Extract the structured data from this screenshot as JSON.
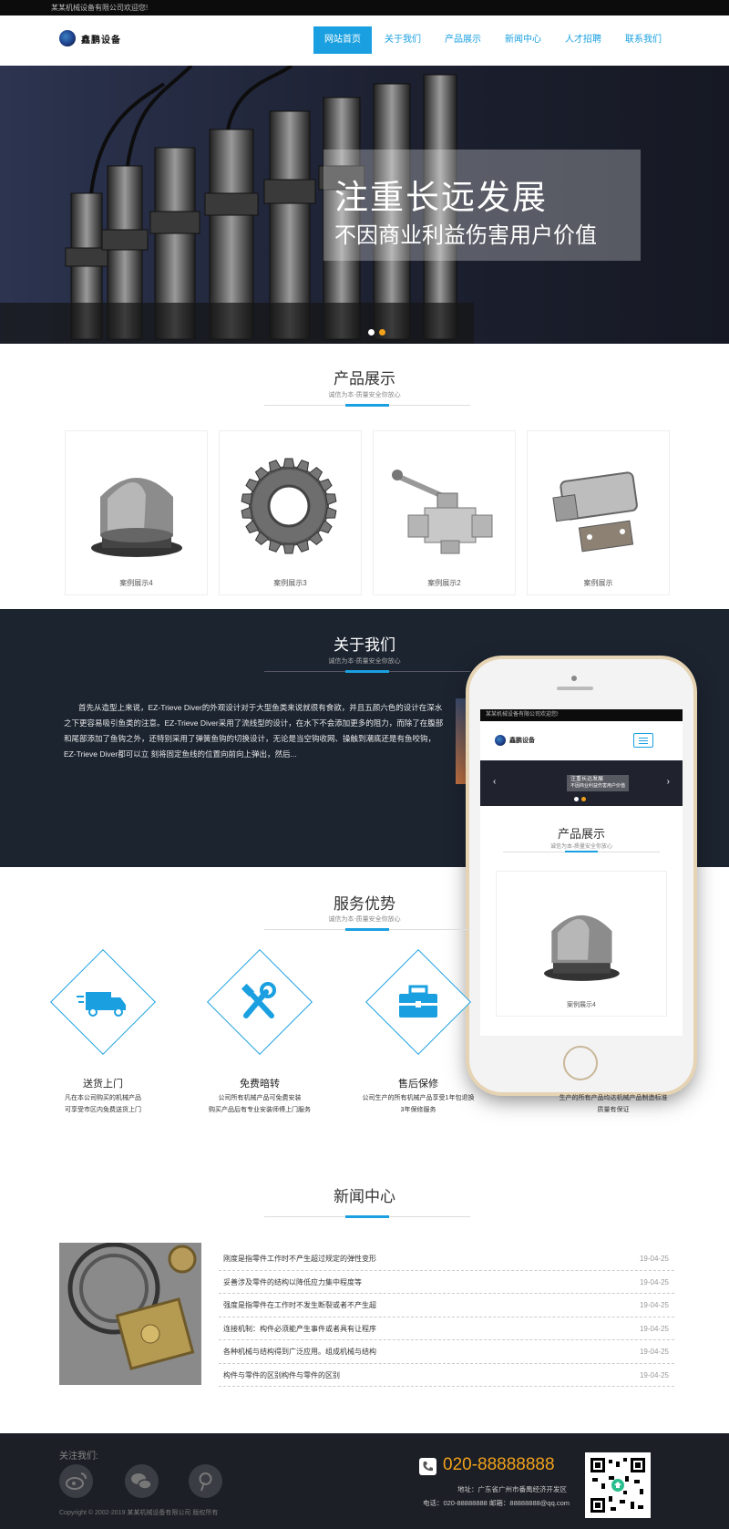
{
  "topbar": {
    "welcome": "某某机械设备有限公司欢迎您!"
  },
  "header": {
    "logo_text": "鑫鹏设备",
    "nav": [
      "网站首页",
      "关于我们",
      "产品展示",
      "新闻中心",
      "人才招聘",
      "联系我们"
    ]
  },
  "hero": {
    "title": "注重长远发展",
    "subtitle": "不因商业利益伤害用户价值"
  },
  "products": {
    "title": "产品展示",
    "subtitle": "诚信为本-质量安全你放心",
    "items": [
      {
        "label": "案例展示4",
        "icon": "cap-part"
      },
      {
        "label": "案例展示3",
        "icon": "gear"
      },
      {
        "label": "案例展示2",
        "icon": "valve"
      },
      {
        "label": "案例展示",
        "icon": "latch"
      }
    ]
  },
  "about": {
    "title": "关于我们",
    "subtitle": "诚信为本-质量安全你放心",
    "text": "首先从造型上来说，EZ-Trieve Diver的外观设计对于大型鱼类来说就很有食欲，并且五颜六色的设计在深水之下更容易吸引鱼类的注意。EZ-Trieve Diver采用了流线型的设计，在水下不会添加更多的阻力，而除了在腹部和尾部添加了鱼钩之外，还特别采用了弹簧鱼钩的切换设计，无论是当空钩收网、操触到潮底还是有鱼咬钩，EZ-Trieve Diver都可以立 刻将固定鱼线的位置向前向上弹出，然后..."
  },
  "phone_mock": {
    "welcome": "某某机械设备有限公司欢迎您!",
    "logo_text": "鑫鹏设备",
    "banner_title": "注重长远发展",
    "banner_sub": "不因商业利益伤害用户价值",
    "section_title": "产品展示",
    "section_sub": "诚信为本-质量安全你放心",
    "product_label": "案例展示4"
  },
  "services": {
    "title": "服务优势",
    "subtitle": "诚信为本-质量安全你放心",
    "items": [
      {
        "title": "送货上门",
        "desc1": "凡在本公司购买的机械产品",
        "desc2": "可享受市区内免费送货上门",
        "icon": "truck-icon"
      },
      {
        "title": "免费暗转",
        "desc1": "公司所有机械产品可免费安装",
        "desc2": "购买产品后有专业安装师傅上门服务",
        "icon": "tools-icon"
      },
      {
        "title": "售后保修",
        "desc1": "公司生产的所有机械产品享受1年包退换",
        "desc2": "3年保修服务",
        "icon": "toolbox-icon"
      },
      {
        "title": "",
        "desc1": "生产的所有产品均达机械产品制造标准",
        "desc2": "质量有保证",
        "icon": ""
      }
    ]
  },
  "news": {
    "title": "新闻中心",
    "items": [
      {
        "title": "刚度是指零件工作时不产生超过规定的弹性变形",
        "date": "19-04-25"
      },
      {
        "title": "妥善涉及零件的结构以降低应力集中程度等",
        "date": "19-04-25"
      },
      {
        "title": "强度是指零件在工作时不发生断裂或者不产生超",
        "date": "19-04-25"
      },
      {
        "title": "连接机制：构件必须能产生事件或者具有让程序",
        "date": "19-04-25"
      },
      {
        "title": "各种机械与结构得到广泛应用。组成机械与结构",
        "date": "19-04-25"
      },
      {
        "title": "构件与零件的区别构件与零件的区别",
        "date": "19-04-25"
      }
    ]
  },
  "footer": {
    "follow_label": "关注我们:",
    "phone": "020-88888888",
    "address": "地址：广东省广州市番禺经济开发区",
    "contact": "电话：020-88888888 邮箱：88888888@qq.com",
    "copyright": "Copyright © 2002-2019 某某机械设备有限公司 版权所有",
    "social": [
      "weibo-icon",
      "wechat-icon",
      "pinterest-icon"
    ]
  },
  "colors": {
    "accent": "#1aa0e0",
    "orange": "#f1a21b",
    "dark": "#1c2430"
  }
}
